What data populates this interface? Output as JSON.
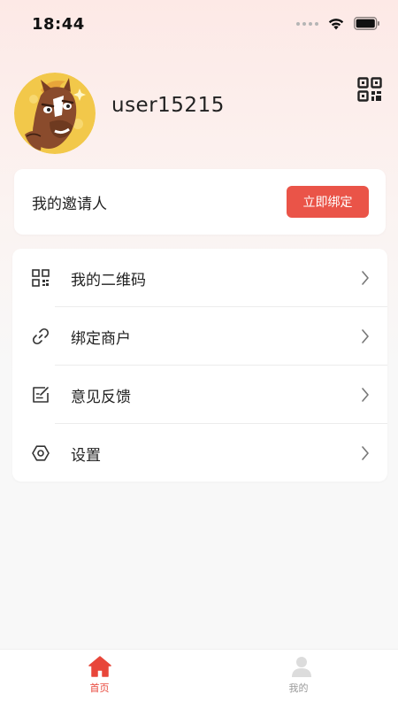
{
  "status_bar": {
    "time": "18:44"
  },
  "profile": {
    "username": "user15215"
  },
  "inviter": {
    "label": "我的邀请人",
    "button_label": "立即绑定"
  },
  "menu": {
    "items": [
      {
        "label": "我的二维码",
        "icon": "qrcode-icon"
      },
      {
        "label": "绑定商户",
        "icon": "link-icon"
      },
      {
        "label": "意见反馈",
        "icon": "feedback-icon"
      },
      {
        "label": "设置",
        "icon": "settings-icon"
      }
    ]
  },
  "tab_bar": {
    "tabs": [
      {
        "label": "首页",
        "icon": "home-icon",
        "active": true
      },
      {
        "label": "我的",
        "icon": "user-icon",
        "active": false
      }
    ]
  },
  "colors": {
    "accent": "#ea5448",
    "active_tab": "#e8463a",
    "inactive_tab": "#999999"
  }
}
